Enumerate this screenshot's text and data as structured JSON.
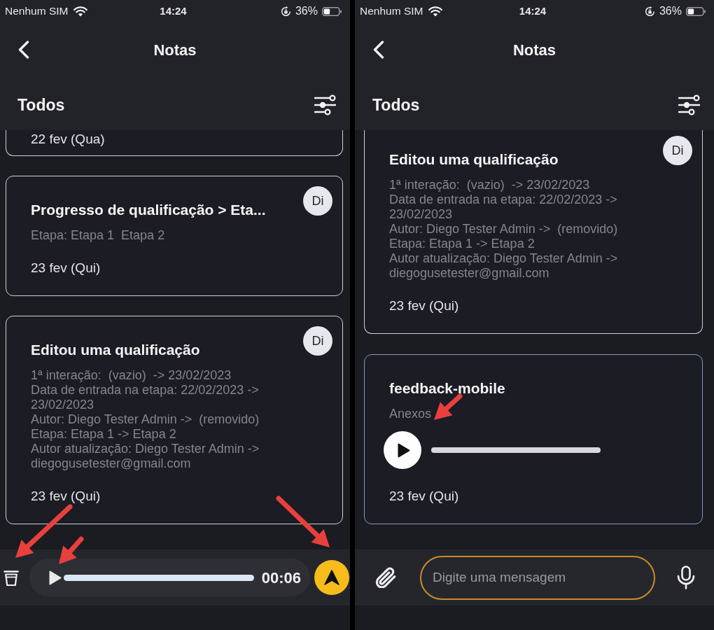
{
  "screens": [
    {
      "status_bar": {
        "carrier": "Nenhum SIM",
        "time": "14:24",
        "battery": "36%"
      },
      "header": {
        "title": "Notas",
        "filter": "Todos"
      },
      "list_scrolled": true,
      "notes": [
        {
          "date": "22 fev (Qua)",
          "highlighted": false
        },
        {
          "title": "Progresso de qualificação > Eta...",
          "avatar": "Di",
          "details": [
            "Etapa: Etapa 1  Etapa 2"
          ],
          "date": "23 fev (Qui)",
          "highlighted": false
        },
        {
          "title": "Editou uma qualificação",
          "avatar": "Di",
          "details": [
            "1ª interação:  (vazio)  -> 23/02/2023",
            "Data de entrada na etapa: 22/02/2023 -> 23/02/2023",
            "Autor: Diego Tester Admin ->  (removido)",
            "Etapa: Etapa 1 -> Etapa 2",
            "Autor atualização: Diego Tester Admin -> diegogusetester@gmail.com"
          ],
          "date": "23 fev (Qui)",
          "highlighted": false
        }
      ],
      "composer": {
        "kind": "recording",
        "duration": "00:06"
      },
      "annotations": [
        {
          "kind": "arrow"
        },
        {
          "kind": "arrow"
        },
        {
          "kind": "arrow"
        }
      ]
    },
    {
      "status_bar": {
        "carrier": "Nenhum SIM",
        "time": "14:24",
        "battery": "36%"
      },
      "header": {
        "title": "Notas",
        "filter": "Todos"
      },
      "list_scrolled": true,
      "notes": [
        {
          "title": "Editou uma qualificação",
          "avatar": "Di",
          "details": [
            "1ª interação:  (vazio)  -> 23/02/2023",
            "Data de entrada na etapa: 22/02/2023 -> 23/02/2023",
            "Autor: Diego Tester Admin ->  (removido)",
            "Etapa: Etapa 1 -> Etapa 2",
            "Autor atualização: Diego Tester Admin -> diegogusetester@gmail.com"
          ],
          "date": "23 fev (Qui)",
          "highlighted": false
        },
        {
          "title": "feedback-mobile",
          "attachments_label": "Anexos",
          "attachments": [
            {
              "kind": "audio"
            }
          ],
          "date": "23 fev (Qui)",
          "highlighted": true
        }
      ],
      "composer": {
        "kind": "message",
        "placeholder": "Digite uma mensagem"
      },
      "annotations": [
        {
          "kind": "arrow"
        }
      ]
    }
  ]
}
